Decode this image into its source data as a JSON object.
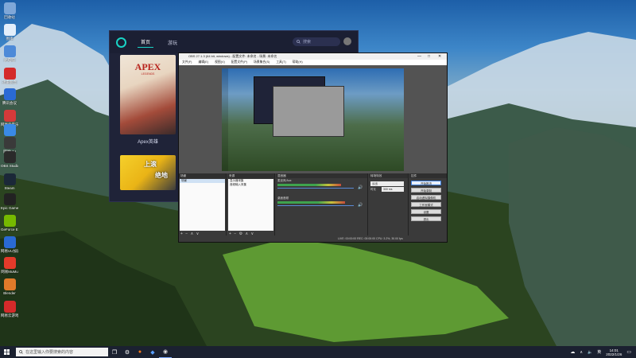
{
  "desktop": {
    "icons": [
      {
        "label": "回收站",
        "icon": "recycle-bin-icon",
        "color": "#7fa7d8"
      },
      {
        "label": "图库",
        "icon": "gallery-icon",
        "color": "#e3eefa"
      },
      {
        "label": "此电脑",
        "icon": "computer-icon",
        "color": "#4d8ad8"
      },
      {
        "label": "迅雷影音",
        "icon": "media-player-icon",
        "color": "#d42a2a"
      },
      {
        "label": "腾讯会议",
        "icon": "meeting-icon",
        "color": "#2a6ad4"
      },
      {
        "label": "网易云音乐",
        "icon": "music-icon",
        "color": "#d43a3a"
      },
      {
        "label": "迅雷",
        "icon": "thunder-icon",
        "color": "#3a8ae6"
      },
      {
        "label": "网易UU",
        "icon": "uu-icon",
        "color": "#3a3a3a"
      },
      {
        "label": "OBS Studio",
        "icon": "obs-icon",
        "color": "#2a2a2a"
      },
      {
        "label": "Steam",
        "icon": "steam-icon",
        "color": "#1b2838"
      },
      {
        "label": "Epic Games Launcher",
        "icon": "epic-icon",
        "color": "#222"
      },
      {
        "label": "GeForce Experience",
        "icon": "geforce-icon",
        "color": "#76b900"
      },
      {
        "label": "网易UU加速器",
        "icon": "accelerator-icon",
        "color": "#2a6ad4"
      },
      {
        "label": "网易MuMu",
        "icon": "mumu-icon",
        "color": "#e33a2a"
      },
      {
        "label": "Blender",
        "icon": "blender-icon",
        "color": "#e07a2a"
      },
      {
        "label": "网易云游戏",
        "icon": "cloud-game-icon",
        "color": "#d42a2a"
      }
    ]
  },
  "launcher": {
    "tabs": [
      "首页",
      "游玩"
    ],
    "search_placeholder": "搜索",
    "featured": {
      "title": "APEX",
      "subtitle": "LEGENDS",
      "label": "Apex英雄"
    },
    "banner": {
      "line1": "上滚",
      "line2": "绝地"
    }
  },
  "obs": {
    "title": "OBS 27.1.3 (64 bit, windows) - 配置文件: 未命名 - 场景: 未命名",
    "menu": [
      "文件(F)",
      "编辑(E)",
      "视图(V)",
      "配置文件(P)",
      "场景集合(S)",
      "工具(T)",
      "帮助(H)"
    ],
    "scenes_header": "场景",
    "scenes": [
      "场景"
    ],
    "sources_header": "来源",
    "sources": [
      "显示器采集",
      "音频输入采集"
    ],
    "mixer_header": "混音器",
    "mixer_tracks": [
      {
        "name": "麦克风/Aux",
        "level": 0.8
      },
      {
        "name": "桌面音频",
        "level": 0.85
      }
    ],
    "transitions_header": "转场特效",
    "transition_type": "淡出",
    "duration_label": "时长",
    "duration_value": "300 ms",
    "controls_header": "控件",
    "controls": [
      "开始推流",
      "开始录制",
      "启动虚拟摄像机",
      "工作室模式",
      "设置",
      "退出"
    ],
    "status": "LIVE: 00:00:00   REC: 00:00:00   CPU: 3.2%, 30.00 fps",
    "scene_transition_label": "转场特效"
  },
  "taskbar": {
    "search_placeholder": "在这里输入你要搜索的内容",
    "time": "14:01",
    "date": "2022/1/26",
    "ime": "英"
  }
}
